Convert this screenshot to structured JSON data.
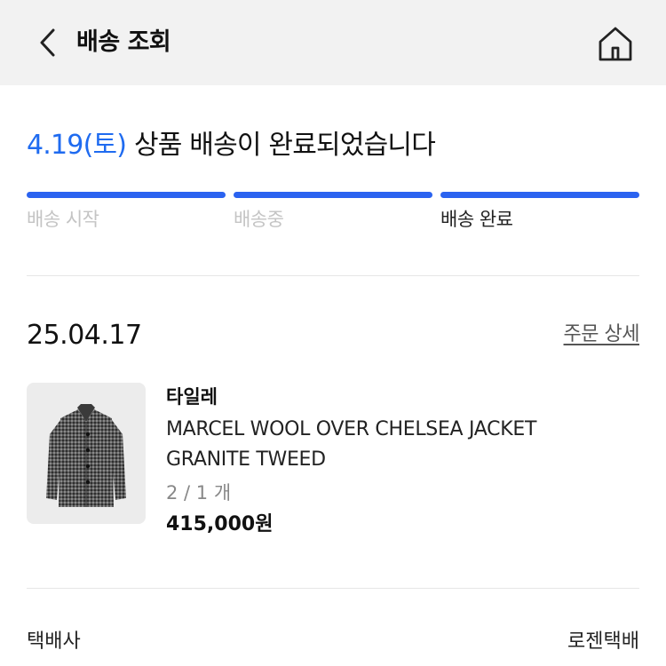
{
  "header": {
    "title": "배송 조회",
    "back_icon": "chevron-left-icon",
    "home_icon": "home-icon"
  },
  "status": {
    "date": "4.19(토)",
    "message": " 상품 배송이 완료되었습니다",
    "date_color": "#1f6bf0",
    "progress_color": "#2b63f0",
    "steps": [
      {
        "label": "배송 시작",
        "active": false
      },
      {
        "label": "배송중",
        "active": false
      },
      {
        "label": "배송 완료",
        "active": true
      }
    ]
  },
  "order": {
    "date": "25.04.17",
    "detail_link": "주문 상세",
    "item": {
      "brand": "타일레",
      "name_line1": "MARCEL WOOL OVER CHELSEA JACKET",
      "name_line2": "GRANITE TWEED",
      "quantity": "2 / 1 개",
      "price": "415,000원"
    }
  },
  "shipping": {
    "carrier_label": "택배사",
    "carrier_name": "로젠택배"
  }
}
